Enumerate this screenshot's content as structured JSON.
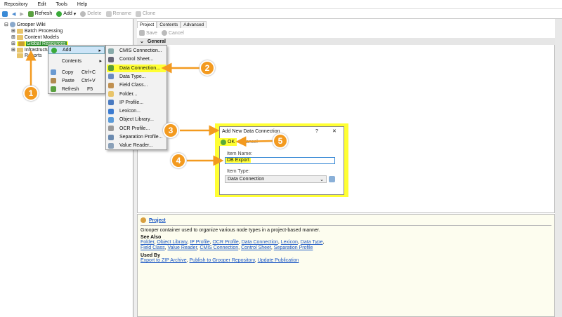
{
  "menu": [
    "Repository",
    "Edit",
    "Tools",
    "Help"
  ],
  "toolbar": {
    "refresh": "Refresh",
    "add": "Add",
    "delete": "Delete",
    "rename": "Rename",
    "clone": "Clone"
  },
  "tree": {
    "root": "Grooper Wiki",
    "items": [
      "Batch Processing",
      "Content Models",
      "Global Resources",
      "Infrastructure",
      "Reports"
    ]
  },
  "context_menu": {
    "add": "Add",
    "contents": "Contents",
    "copy": "Copy",
    "copy_key": "Ctrl+C",
    "paste": "Paste",
    "paste_key": "Ctrl+V",
    "refresh": "Refresh",
    "refresh_key": "F5"
  },
  "submenu": [
    "CMIS Connection...",
    "Control Sheet...",
    "Data Connection...",
    "Data Type...",
    "Field Class...",
    "Folder...",
    "IP Profile...",
    "Lexicon...",
    "Object Library...",
    "OCR Profile...",
    "Separation Profile...",
    "Value Reader..."
  ],
  "right": {
    "tabs": [
      "Project",
      "Contents",
      "Advanced"
    ],
    "save": "Save",
    "cancel": "Cancel",
    "section": "General"
  },
  "dialog": {
    "title": "Add New Data Connection",
    "help": "?",
    "close": "✕",
    "ok": "OK",
    "cancel": "Cancel",
    "item_name_label": "Item Name:",
    "item_name_value": "DB Export",
    "item_type_label": "Item Type:",
    "item_type_value": "Data Connection"
  },
  "help": {
    "title": "Project",
    "description": "Grooper container used to organize various node types in a project-based manner.",
    "see_also_label": "See Also",
    "see_also": [
      "Folder",
      "Object Library",
      "IP Profile",
      "OCR Profile",
      "Data Connection",
      "Lexicon",
      "Data Type",
      "Field Class",
      "Value Reader",
      "CMIS Connection",
      "Control Sheet",
      "Separation Profile"
    ],
    "used_by_label": "Used By",
    "used_by": [
      "Export to ZIP Archive",
      "Publish to Grooper Repository",
      "Update Publication"
    ]
  },
  "callouts": [
    "1",
    "2",
    "3",
    "4",
    "5"
  ],
  "colors": {
    "callout": "#f39a1f",
    "highlight": "#ffff33",
    "link": "#1a56c4"
  }
}
